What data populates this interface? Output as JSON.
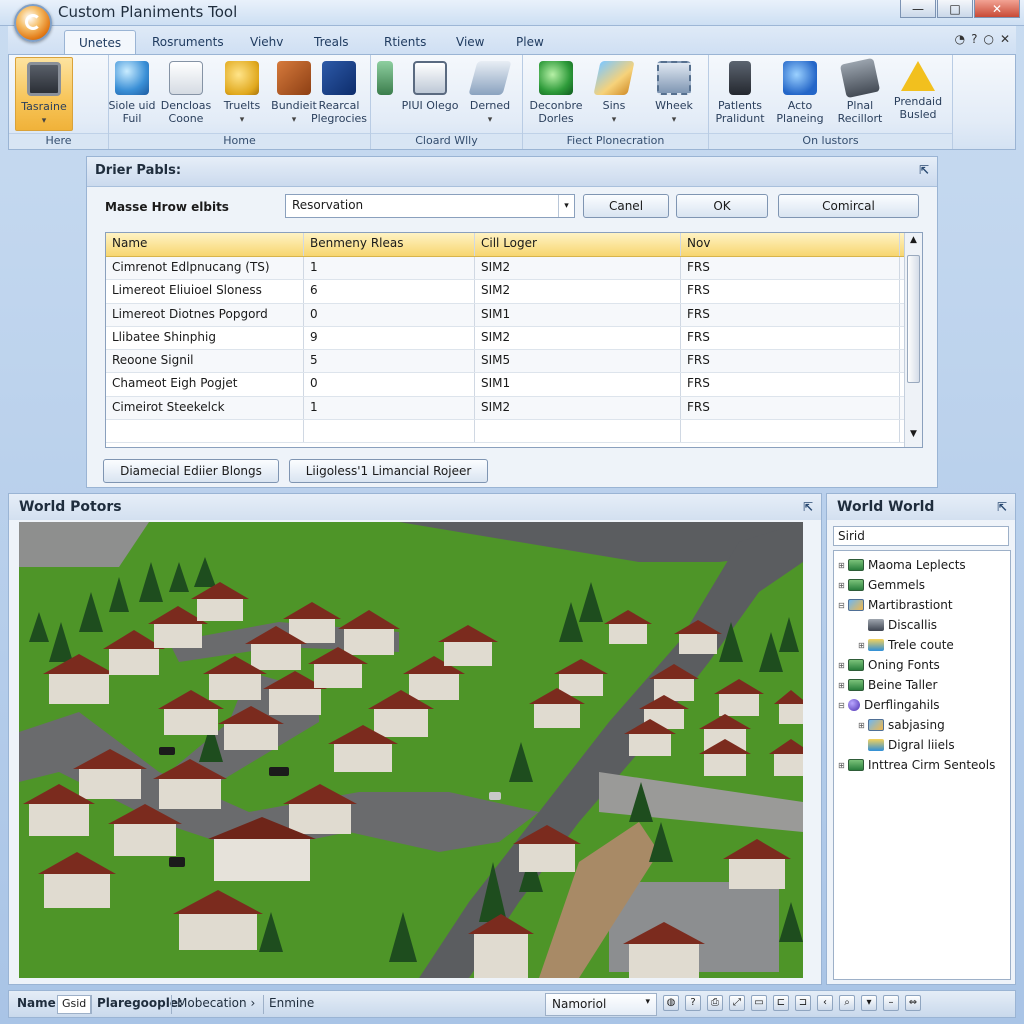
{
  "window": {
    "title": "Custom Planiments Tool",
    "buttons": {
      "minimize": "—",
      "maximize": "□",
      "close": "✕"
    }
  },
  "ribbon_tabs": [
    {
      "label": "Unetes",
      "active": true
    },
    {
      "label": "Rosruments"
    },
    {
      "label": "Viehv"
    },
    {
      "label": "Treals"
    },
    {
      "label": "Rtients"
    },
    {
      "label": "View"
    },
    {
      "label": "Plew"
    }
  ],
  "tab_ctrls": [
    "◔",
    "?",
    "○",
    "✕"
  ],
  "ribbon_groups": [
    {
      "label": "Here",
      "buttons": [
        {
          "label": "Tasraine",
          "icon": "monitor-icon",
          "caret": "▾"
        }
      ]
    },
    {
      "label": "Home",
      "buttons": [
        {
          "label": "Siole uid Fuil",
          "icon": "globe-icon"
        },
        {
          "label": "Dencloas Coone",
          "icon": "document-icon"
        },
        {
          "label": "Truelts",
          "icon": "money-icon",
          "caret": "▾"
        },
        {
          "label": "Bundieit",
          "icon": "box-icon",
          "caret": "▾"
        },
        {
          "label": "Rearcal Plegrocies",
          "icon": "cube-icon"
        }
      ]
    },
    {
      "label": "Cloard Wlly",
      "buttons": [
        {
          "label": "",
          "icon": "tower-icon"
        },
        {
          "label": "PIUI Olego",
          "icon": "frame-icon"
        },
        {
          "label": "Derned",
          "icon": "tray-icon",
          "caret": "▾"
        }
      ]
    },
    {
      "label": "Fiect Plonecration",
      "buttons": [
        {
          "label": "Deconbre Dorles",
          "icon": "disc-icon"
        },
        {
          "label": "Sins",
          "icon": "photo-icon",
          "caret": "▾"
        },
        {
          "label": "Wheek",
          "icon": "wheel-icon",
          "caret": "▾"
        }
      ]
    },
    {
      "label": "On lustors",
      "buttons": [
        {
          "label": "Patlents Pralidunt",
          "icon": "phone-icon"
        },
        {
          "label": "Acto Planeing",
          "icon": "bird-icon"
        },
        {
          "label": "Plnal Recillort",
          "icon": "calculator-icon"
        },
        {
          "label": "Prendaid Busled",
          "icon": "warning-icon"
        }
      ]
    }
  ],
  "dialog": {
    "title": "Drier Pabls:",
    "pin": "⇱",
    "filter_label": "Masse Hrow elbits",
    "combo_value": "Resorvation",
    "combo_arrow": "▾",
    "buttons": {
      "cancel": "Canel",
      "ok": "OK",
      "other": "Comircal"
    },
    "columns": [
      "Name",
      "Benmeny Rleas",
      "Cill Loger",
      "Nov"
    ],
    "rows": [
      [
        "Cimrenot Edlpnucang (TS)",
        "1",
        "SIM2",
        "FRS"
      ],
      [
        "Limereot Eliuioel Sloness",
        "6",
        "SIM2",
        "FRS"
      ],
      [
        "Limereot Diotnes Popgord",
        "0",
        "SIM1",
        "FRS"
      ],
      [
        "Llibatee Shinphig",
        "9",
        "SIM2",
        "FRS"
      ],
      [
        "Reoone Signil",
        "5",
        "SIM5",
        "FRS"
      ],
      [
        "Chameot Eigh Pogjet",
        "0",
        "SIM1",
        "FRS"
      ],
      [
        "Cimeirot Steekelck",
        "1",
        "SIM2",
        "FRS"
      ],
      [
        "",
        "",
        "",
        ""
      ]
    ],
    "scroll": {
      "up": "▲",
      "down": "▼"
    },
    "bottom_buttons": [
      "Diamecial Ediier Blongs",
      "Liigoless'1 Limancial Rojeer"
    ]
  },
  "world": {
    "title": "World Potors",
    "pin": "⇱"
  },
  "tree_panel": {
    "title": "World World",
    "pin": "⇱",
    "search_value": "Sirid",
    "nodes": [
      {
        "label": "Maoma Leplects",
        "depth": 0,
        "exp": "⊞",
        "icon": "net"
      },
      {
        "label": "Gemmels",
        "depth": 0,
        "exp": "⊞",
        "icon": "net"
      },
      {
        "label": "Martibrastiont",
        "depth": 0,
        "exp": "⊟",
        "icon": "img"
      },
      {
        "label": "Discallis",
        "depth": 1,
        "exp": "",
        "icon": "wr"
      },
      {
        "label": "Trele coute",
        "depth": 1,
        "exp": "⊞",
        "icon": "cup"
      },
      {
        "label": "Oning Fonts",
        "depth": 0,
        "exp": "⊞",
        "icon": "net"
      },
      {
        "label": "Beine Taller",
        "depth": 0,
        "exp": "⊞",
        "icon": "net"
      },
      {
        "label": "Derflingahils",
        "depth": 0,
        "exp": "⊟",
        "icon": "ball"
      },
      {
        "label": "sabjasing",
        "depth": 1,
        "exp": "⊞",
        "icon": "img"
      },
      {
        "label": "Digral liiels",
        "depth": 1,
        "exp": "",
        "icon": "cup"
      },
      {
        "label": "Inttrea Cirm Senteols",
        "depth": 0,
        "exp": "⊞",
        "icon": "net"
      }
    ]
  },
  "statusbar": {
    "name_label": "Name",
    "name_value": "Gsid",
    "field1": "Plaregoople:",
    "field2": "Mobecation ›",
    "field3": "Enmine",
    "combo": "Namoriol",
    "combo_arrow": "▾",
    "icons": [
      "◍",
      "?",
      "⎙",
      "⤢",
      "▭",
      "⊏",
      "⊐",
      "‹",
      "⌕",
      "▾",
      "–",
      "⇔"
    ]
  }
}
